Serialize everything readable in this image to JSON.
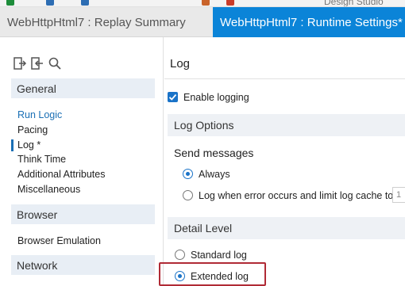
{
  "colors": {
    "accent": "#0b84d8",
    "link": "#1a6fb5",
    "highlight_border": "#b02a35"
  },
  "toolbar": {
    "icons": [
      "save-icon",
      "undo-icon",
      "redo-icon",
      "edit-icon",
      "play-icon"
    ],
    "right_label": "Design Studio"
  },
  "tabs": [
    {
      "label": "WebHttpHtml7 : Replay Summary",
      "active": false
    },
    {
      "label": "WebHttpHtml7 : Runtime Settings*",
      "active": true
    }
  ],
  "sidebar": {
    "tools": [
      "export-icon",
      "import-icon",
      "search-icon"
    ],
    "sections": [
      {
        "title": "General",
        "items": [
          "Run Logic",
          "Pacing",
          "Log *",
          "Think Time",
          "Additional Attributes",
          "Miscellaneous"
        ]
      },
      {
        "title": "Browser",
        "items": [
          "Browser Emulation"
        ]
      },
      {
        "title": "Network",
        "items": []
      }
    ],
    "selected_item": "Log *"
  },
  "main": {
    "title": "Log",
    "enable_logging": {
      "label": "Enable logging",
      "checked": true
    },
    "log_options": {
      "title": "Log Options",
      "send_messages": {
        "label": "Send messages",
        "options": [
          "Always",
          "Log when error occurs and limit log cache to"
        ],
        "selected": "Always",
        "cache_value": "1"
      }
    },
    "detail_level": {
      "title": "Detail Level",
      "options": [
        "Standard log",
        "Extended log"
      ],
      "selected": "Extended log"
    }
  }
}
